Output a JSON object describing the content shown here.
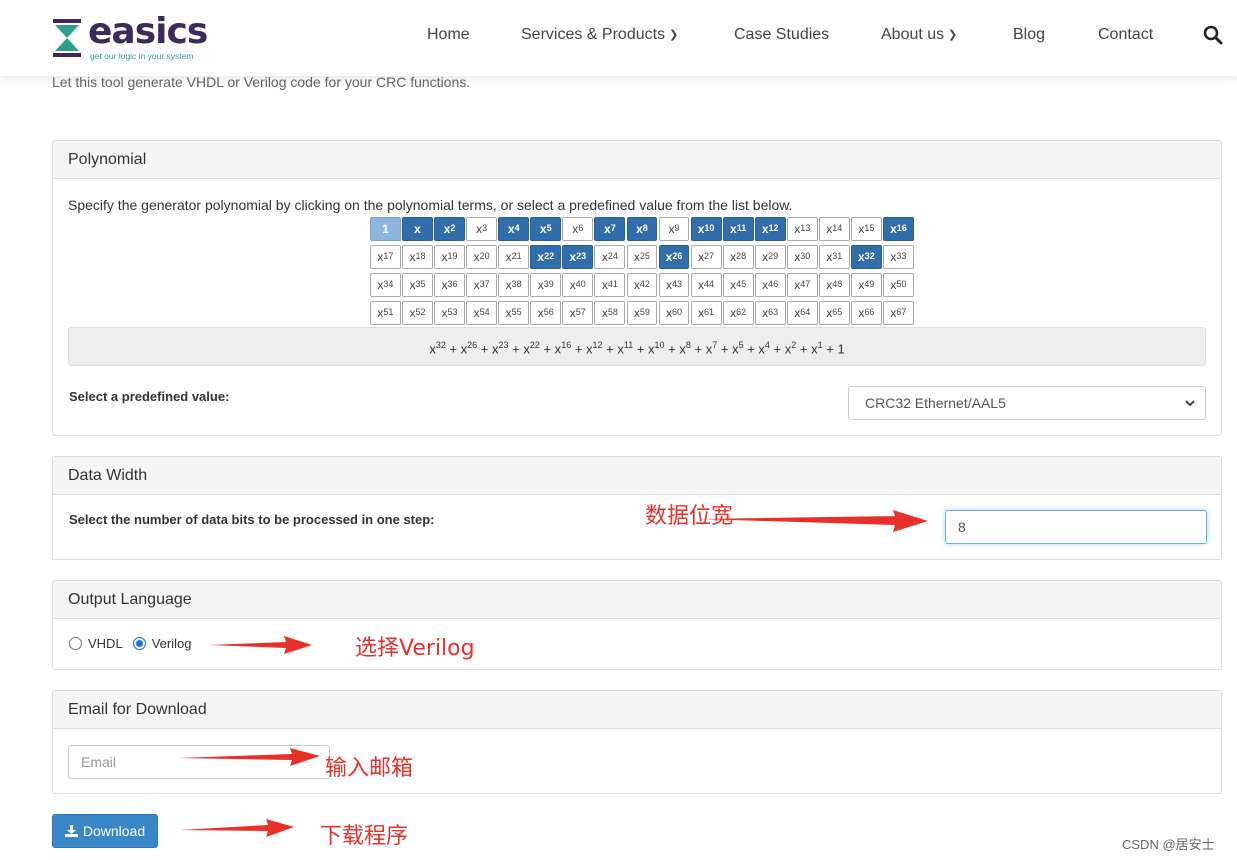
{
  "brand": {
    "name": "easics",
    "tagline": "get our logic in your system"
  },
  "nav": [
    {
      "label": "Home",
      "dropdown": false
    },
    {
      "label": "Services & Products",
      "dropdown": true
    },
    {
      "label": "Case Studies",
      "dropdown": false
    },
    {
      "label": "About us",
      "dropdown": true
    },
    {
      "label": "Blog",
      "dropdown": false
    },
    {
      "label": "Contact",
      "dropdown": false
    }
  ],
  "intro": "Let this tool generate VHDL or Verilog code for your CRC functions.",
  "polynomial": {
    "title": "Polynomial",
    "description": "Specify the generator polynomial by clicking on the polynomial terms, or select a predefined value from the list below.",
    "selected_exponents": [
      0,
      1,
      2,
      4,
      5,
      7,
      8,
      10,
      11,
      12,
      16,
      22,
      23,
      26,
      32
    ],
    "max_exponent": 67,
    "expression": "x32 + x26 + x23 + x22 + x16 + x12 + x11 + x10 + x8 + x7 + x5 + x4 + x2 + x1 + 1",
    "predefined_label": "Select a predefined value:",
    "predefined_value": "CRC32 Ethernet/AAL5"
  },
  "data_width": {
    "title": "Data Width",
    "label": "Select the number of data bits to be processed in one step:",
    "value": "8"
  },
  "output_language": {
    "title": "Output Language",
    "options": [
      "VHDL",
      "Verilog"
    ],
    "selected": "Verilog"
  },
  "email": {
    "title": "Email for Download",
    "placeholder": "Email"
  },
  "download_label": "Download",
  "annotations": {
    "data_width": "数据位宽",
    "select_verilog": "选择Verilog",
    "enter_email": "输入邮箱",
    "download_program": "下载程序"
  },
  "colors": {
    "term_on": "#2f6eab",
    "annotation": "#e8302a",
    "button": "#3a87c8"
  },
  "watermark": "CSDN @居安士"
}
